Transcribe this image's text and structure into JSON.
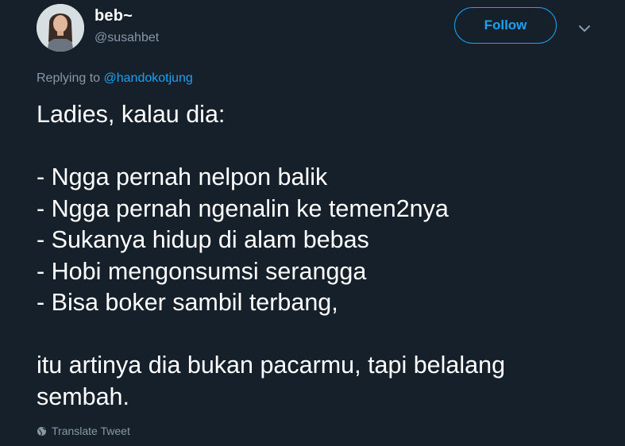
{
  "user": {
    "display_name": "beb~",
    "handle": "@susahbet"
  },
  "actions": {
    "follow_label": "Follow"
  },
  "reply": {
    "prefix": "Replying to",
    "mention": "@handokotjung"
  },
  "tweet": {
    "lines": [
      "Ladies, kalau dia:",
      "",
      "- Ngga pernah nelpon balik",
      "- Ngga pernah ngenalin ke temen2nya",
      "- Sukanya hidup di alam bebas",
      "- Hobi mengonsumsi serangga",
      "- Bisa boker sambil terbang,",
      "",
      "itu artinya dia bukan pacarmu, tapi belalang",
      "sembah."
    ]
  },
  "footer": {
    "translate_label": "Translate Tweet"
  },
  "icons": {
    "caret": "chevron-down-icon",
    "globe": "globe-icon"
  },
  "colors": {
    "background": "#15202b",
    "accent": "#1da1f2",
    "secondary_text": "#8899a6"
  }
}
